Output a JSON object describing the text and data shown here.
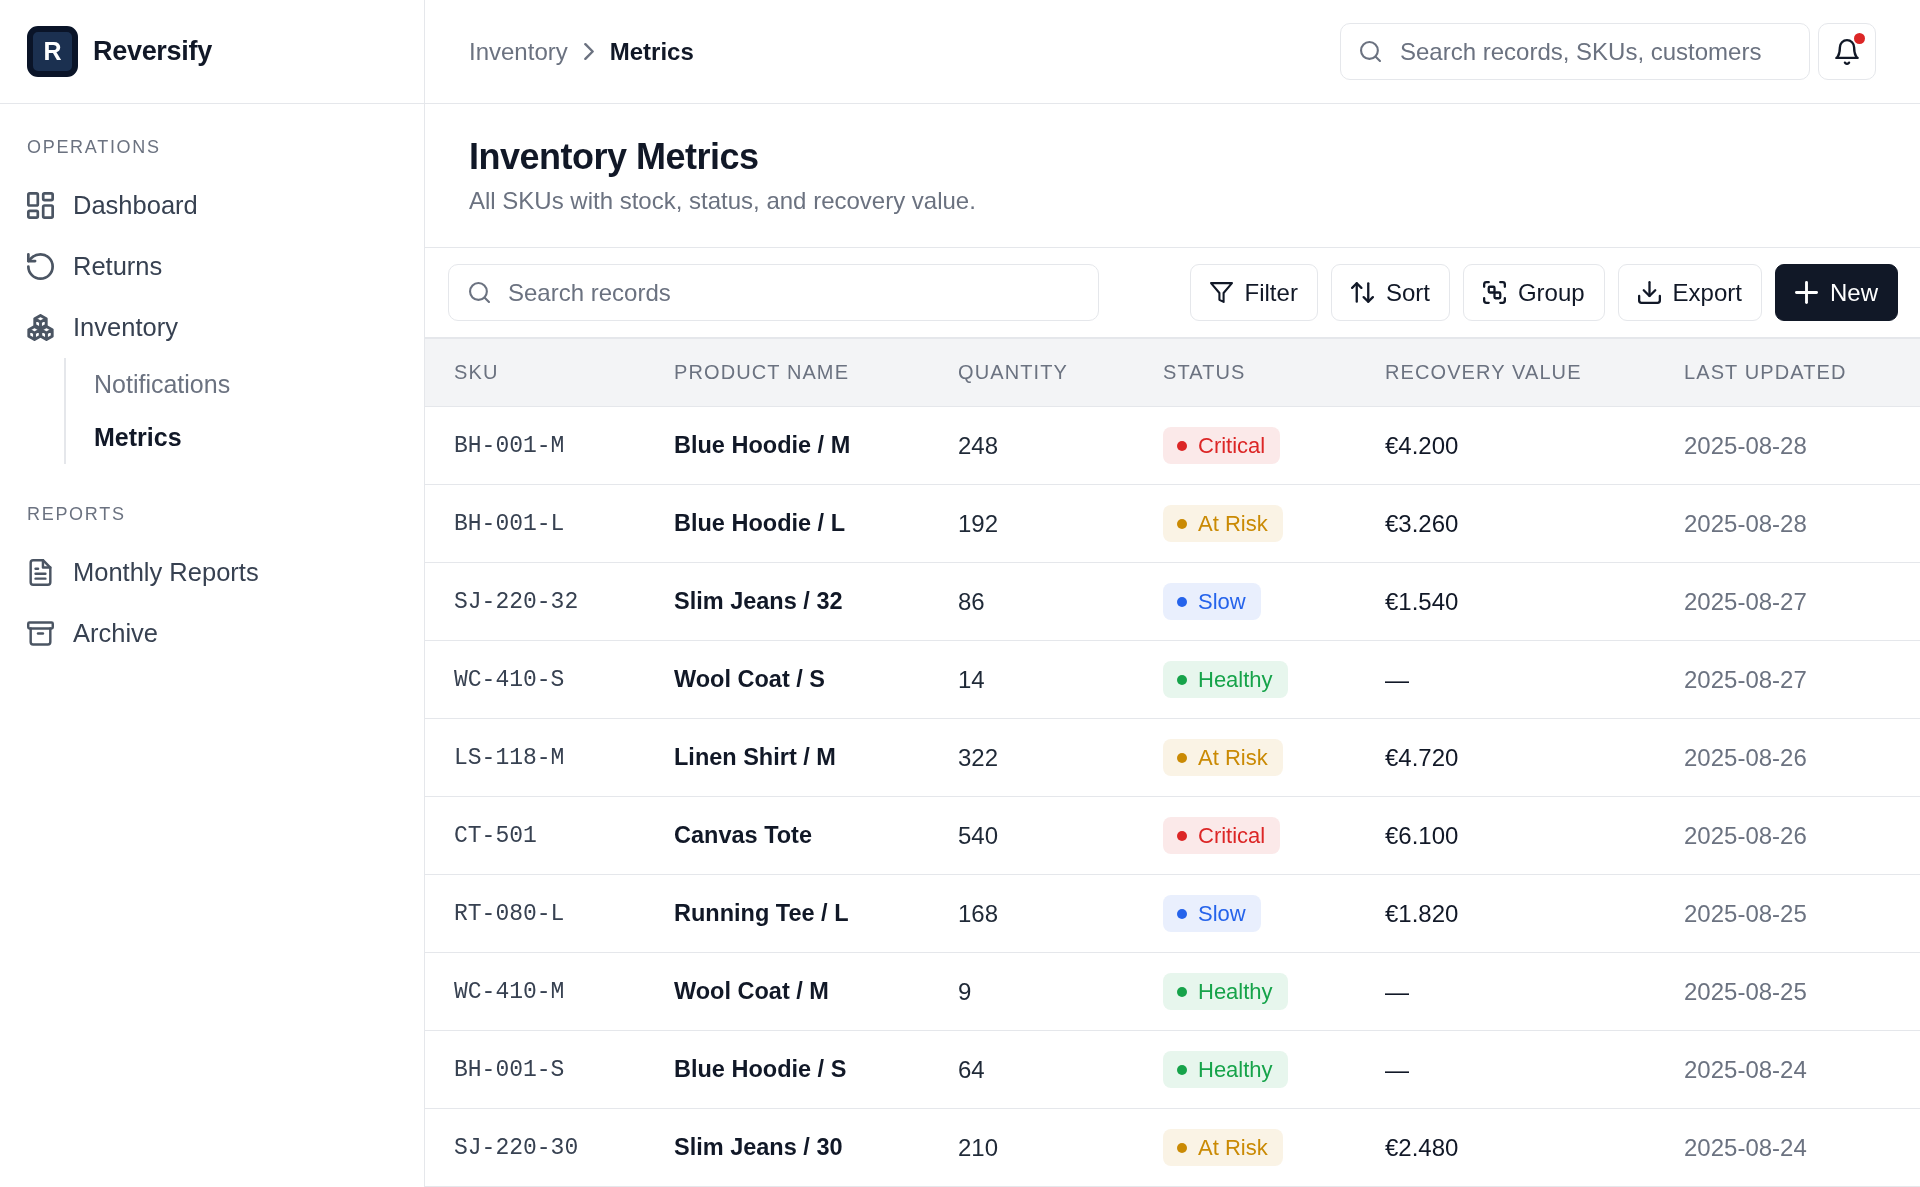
{
  "sidebar": {
    "brand": {
      "logo_text": "R",
      "name": "Reversify"
    },
    "sections": [
      {
        "title": "OPERATIONS",
        "items": [
          {
            "label": "Dashboard",
            "selected": false
          },
          {
            "label": "Returns",
            "selected": false
          },
          {
            "label": "Inventory",
            "selected": false,
            "children": [
              {
                "label": "Notifications",
                "selected": false
              },
              {
                "label": "Metrics",
                "selected": true
              }
            ]
          }
        ]
      },
      {
        "title": "REPORTS",
        "items": [
          {
            "label": "Monthly Reports",
            "selected": false
          },
          {
            "label": "Archive",
            "selected": false
          }
        ]
      }
    ]
  },
  "header": {
    "breadcrumb": [
      {
        "label": "Inventory",
        "current": false
      },
      {
        "label": "Metrics",
        "current": true
      }
    ],
    "search": {
      "placeholder": "Search records, SKUs, customers"
    },
    "notifications": {
      "unread": true
    }
  },
  "page": {
    "title": "Inventory Metrics",
    "subtitle": "All SKUs with stock, status, and recovery value."
  },
  "toolbar": {
    "search": {
      "placeholder": "Search records"
    },
    "buttons": [
      {
        "label": "Filter",
        "kind": "secondary"
      },
      {
        "label": "Sort",
        "kind": "secondary"
      },
      {
        "label": "Group",
        "kind": "secondary"
      },
      {
        "label": "Export",
        "kind": "secondary"
      },
      {
        "label": "New",
        "kind": "primary"
      }
    ]
  },
  "table": {
    "columns": [
      "SKU",
      "PRODUCT NAME",
      "QUANTITY",
      "STATUS",
      "RECOVERY VALUE",
      "LAST UPDATED"
    ],
    "rows": [
      {
        "sku": "BH-001-M",
        "product_name": "Blue Hoodie / M",
        "quantity": "248",
        "status": {
          "label": "Critical",
          "color": "#dc2626"
        },
        "recovery_value": "€4.200",
        "last_updated": "2025-08-28"
      },
      {
        "sku": "BH-001-L",
        "product_name": "Blue Hoodie / L",
        "quantity": "192",
        "status": {
          "label": "At Risk",
          "color": "#ca8a04"
        },
        "recovery_value": "€3.260",
        "last_updated": "2025-08-28"
      },
      {
        "sku": "SJ-220-32",
        "product_name": "Slim Jeans / 32",
        "quantity": "86",
        "status": {
          "label": "Slow",
          "color": "#2563eb"
        },
        "recovery_value": "€1.540",
        "last_updated": "2025-08-27"
      },
      {
        "sku": "WC-410-S",
        "product_name": "Wool Coat / S",
        "quantity": "14",
        "status": {
          "label": "Healthy",
          "color": "#16a34a"
        },
        "recovery_value": "—",
        "last_updated": "2025-08-27"
      },
      {
        "sku": "LS-118-M",
        "product_name": "Linen Shirt / M",
        "quantity": "322",
        "status": {
          "label": "At Risk",
          "color": "#ca8a04"
        },
        "recovery_value": "€4.720",
        "last_updated": "2025-08-26"
      },
      {
        "sku": "CT-501",
        "product_name": "Canvas Tote",
        "quantity": "540",
        "status": {
          "label": "Critical",
          "color": "#dc2626"
        },
        "recovery_value": "€6.100",
        "last_updated": "2025-08-26"
      },
      {
        "sku": "RT-080-L",
        "product_name": "Running Tee / L",
        "quantity": "168",
        "status": {
          "label": "Slow",
          "color": "#2563eb"
        },
        "recovery_value": "€1.820",
        "last_updated": "2025-08-25"
      },
      {
        "sku": "WC-410-M",
        "product_name": "Wool Coat / M",
        "quantity": "9",
        "status": {
          "label": "Healthy",
          "color": "#16a34a"
        },
        "recovery_value": "—",
        "last_updated": "2025-08-25"
      },
      {
        "sku": "BH-001-S",
        "product_name": "Blue Hoodie / S",
        "quantity": "64",
        "status": {
          "label": "Healthy",
          "color": "#16a34a"
        },
        "recovery_value": "—",
        "last_updated": "2025-08-24"
      },
      {
        "sku": "SJ-220-30",
        "product_name": "Slim Jeans / 30",
        "quantity": "210",
        "status": {
          "label": "At Risk",
          "color": "#ca8a04"
        },
        "recovery_value": "€2.480",
        "last_updated": "2025-08-24"
      }
    ]
  }
}
